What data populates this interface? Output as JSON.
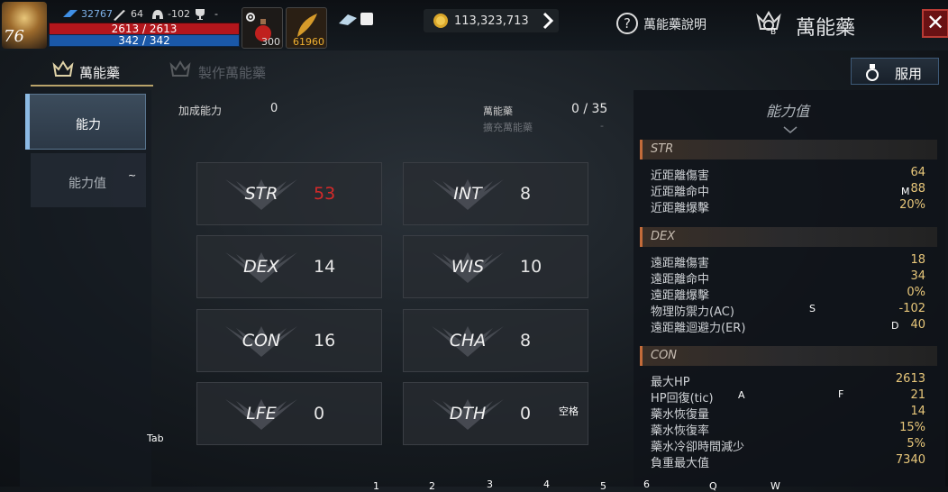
{
  "hud": {
    "level": "76",
    "exp_value": "32767",
    "sword_value": "64",
    "armor_value": "-102",
    "trophy_value": "-",
    "hp_text": "2613 / 2613",
    "mp_text": "342 / 342",
    "slot1_count": "300",
    "slot2_count": "61960",
    "gold": "113,323,713",
    "help_label": "萬能藥說明",
    "title": "萬能藥",
    "title_badge": "B"
  },
  "tabs": {
    "active_label": "萬能藥",
    "inactive_label": "製作萬能藥",
    "use_button": "服用"
  },
  "sidebar": {
    "items": [
      {
        "label": "能力"
      },
      {
        "label": "能力值",
        "badge": "~"
      }
    ]
  },
  "summary": {
    "bonus_label": "加成能力",
    "bonus_value": "0",
    "slots_label": "萬能藥",
    "slots_value": "0 / 35",
    "expand_label": "擴充萬能藥",
    "expand_value": "-"
  },
  "stats": [
    {
      "name": "STR",
      "value": "53",
      "color": "#d42a2a"
    },
    {
      "name": "INT",
      "value": "8",
      "color": "#e6e6e6"
    },
    {
      "name": "DEX",
      "value": "14",
      "color": "#e6e6e6"
    },
    {
      "name": "WIS",
      "value": "10",
      "color": "#e6e6e6"
    },
    {
      "name": "CON",
      "value": "16",
      "color": "#e6e6e6"
    },
    {
      "name": "CHA",
      "value": "8",
      "color": "#e6e6e6"
    },
    {
      "name": "LFE",
      "value": "0",
      "color": "#e6e6e6"
    },
    {
      "name": "DTH",
      "value": "0",
      "color": "#e6e6e6"
    }
  ],
  "panel": {
    "title": "能力值",
    "sections": [
      {
        "name": "STR",
        "rows": [
          {
            "label": "近距離傷害",
            "value": "64"
          },
          {
            "label": "近距離命中",
            "value": "88"
          },
          {
            "label": "近距離爆擊",
            "value": "20%"
          }
        ]
      },
      {
        "name": "DEX",
        "rows": [
          {
            "label": "遠距離傷害",
            "value": "18"
          },
          {
            "label": "遠距離命中",
            "value": "34"
          },
          {
            "label": "遠距離爆擊",
            "value": "0%"
          },
          {
            "label": "物理防禦力(AC)",
            "value": "-102"
          },
          {
            "label": "遠距離迴避力(ER)",
            "value": "40"
          }
        ]
      },
      {
        "name": "CON",
        "rows": [
          {
            "label": "最大HP",
            "value": "2613"
          },
          {
            "label": "HP回復(tic)",
            "value": "21"
          },
          {
            "label": "藥水恢復量",
            "value": "14"
          },
          {
            "label": "藥水恢復率",
            "value": "15%"
          },
          {
            "label": "藥水冷卻時間減少",
            "value": "5%"
          },
          {
            "label": "負重最大值",
            "value": "7340"
          }
        ]
      }
    ]
  },
  "key_hints": {
    "m": "M",
    "s": "S",
    "d": "D",
    "a": "A",
    "f": "F",
    "tab": "Tab",
    "space": "空格",
    "n1": "1",
    "n2": "2",
    "n3": "3",
    "n4": "4",
    "n5": "5",
    "n6": "6",
    "q": "Q",
    "w": "W"
  },
  "colors": {
    "accent_gold": "#e8c77a",
    "str_red": "#d42a2a",
    "section_bar": "#c46c3a"
  }
}
